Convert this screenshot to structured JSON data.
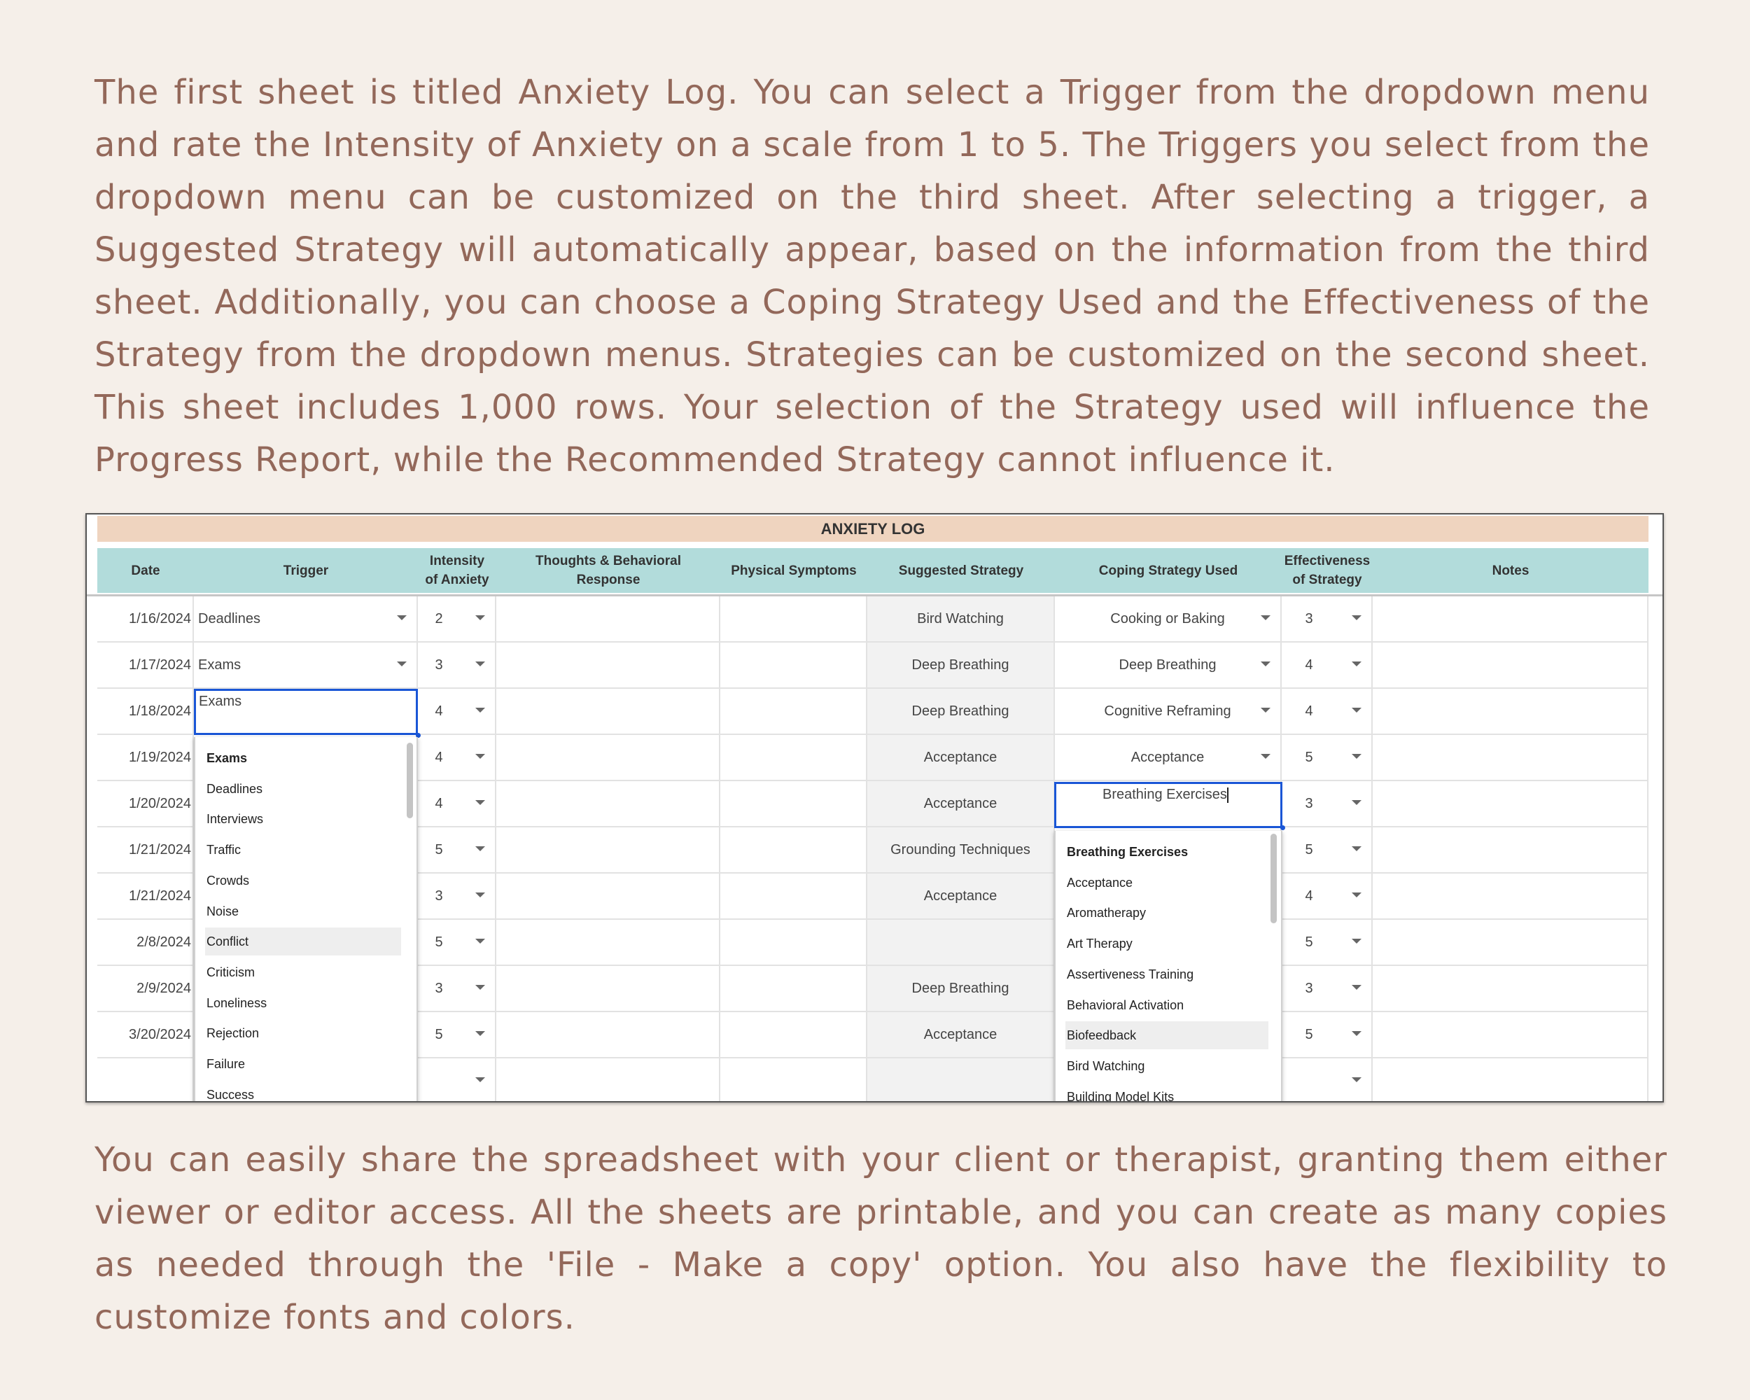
{
  "intro_text": "The first sheet is titled Anxiety Log. You can select a Trigger from the dropdown menu and rate the Intensity of Anxiety on a scale from 1 to 5. The Triggers you select from the dropdown menu can be customized on the third sheet. After selecting a trigger, a Suggested Strategy will automatically appear, based on the information from the third sheet. Additionally, you can choose a Coping Strategy Used and the Effectiveness of the Strategy from the dropdown menus. Strategies can be customized on the second sheet. This sheet includes 1,000 rows. Your selection of the Strategy used will influence the Progress Report, while the Recommended Strategy cannot influence it.",
  "outro_text": "You can easily share the spreadsheet with your client or therapist, granting them either viewer or editor access. All the sheets are printable, and you can create as many copies as needed through the 'File - Make a copy' option. You also have the flexibility to customize fonts and colors.",
  "sheet": {
    "title": "ANXIETY LOG",
    "headers": {
      "date": "Date",
      "trigger": "Trigger",
      "intensity_1": "Intensity",
      "intensity_2": "of Anxiety",
      "thoughts_1": "Thoughts & Behavioral",
      "thoughts_2": "Response",
      "physical": "Physical Symptoms",
      "suggested": "Suggested Strategy",
      "coping": "Coping Strategy Used",
      "effect_1": "Effectiveness",
      "effect_2": "of Strategy",
      "notes": "Notes"
    },
    "rows": [
      {
        "date": "1/16/2024",
        "trigger": "Deadlines",
        "intensity": "2",
        "suggested": "Bird Watching",
        "coping": "Cooking or Baking",
        "effectiveness": "3"
      },
      {
        "date": "1/17/2024",
        "trigger": "Exams",
        "intensity": "3",
        "suggested": "Deep Breathing",
        "coping": "Deep Breathing",
        "effectiveness": "4"
      },
      {
        "date": "1/18/2024",
        "trigger": "",
        "intensity": "4",
        "suggested": "Deep Breathing",
        "coping": "Cognitive Reframing",
        "effectiveness": "4"
      },
      {
        "date": "1/19/2024",
        "trigger": "",
        "intensity": "4",
        "suggested": "Acceptance",
        "coping": "Acceptance",
        "effectiveness": "5"
      },
      {
        "date": "1/20/2024",
        "trigger": "",
        "intensity": "4",
        "suggested": "Acceptance",
        "coping": "",
        "effectiveness": "3"
      },
      {
        "date": "1/21/2024",
        "trigger": "",
        "intensity": "5",
        "suggested": "Grounding Techniques",
        "coping": "",
        "effectiveness": "5"
      },
      {
        "date": "1/21/2024",
        "trigger": "",
        "intensity": "3",
        "suggested": "Acceptance",
        "coping": "",
        "effectiveness": "4"
      },
      {
        "date": "2/8/2024",
        "trigger": "",
        "intensity": "5",
        "suggested": "",
        "coping": "",
        "effectiveness": "5"
      },
      {
        "date": "2/9/2024",
        "trigger": "",
        "intensity": "3",
        "suggested": "Deep Breathing",
        "coping": "",
        "effectiveness": "3"
      },
      {
        "date": "3/20/2024",
        "trigger": "",
        "intensity": "5",
        "suggested": "Acceptance",
        "coping": "",
        "effectiveness": "5"
      },
      {
        "date": "",
        "trigger": "",
        "intensity": "",
        "suggested": "",
        "coping": "",
        "effectiveness": ""
      }
    ],
    "trigger_editor_value": "Exams",
    "trigger_options": [
      "Exams",
      "Deadlines",
      "Interviews",
      "Traffic",
      "Crowds",
      "Noise",
      "Conflict",
      "Criticism",
      "Loneliness",
      "Rejection",
      "Failure",
      "Success"
    ],
    "trigger_highlighted": "Conflict",
    "coping_editor_value": "Breathing Exercises",
    "coping_options": [
      "Breathing Exercises",
      "Acceptance",
      "Aromatherapy",
      "Art Therapy",
      "Assertiveness Training",
      "Behavioral Activation",
      "Biofeedback",
      "Bird Watching",
      "Building Model Kits"
    ],
    "coping_highlighted": "Biofeedback"
  },
  "colors": {
    "background": "#f5efe9",
    "text": "#93685a",
    "title_bar": "#efd4bf",
    "header": "#b2dcdb",
    "selection": "#1a56d6"
  }
}
